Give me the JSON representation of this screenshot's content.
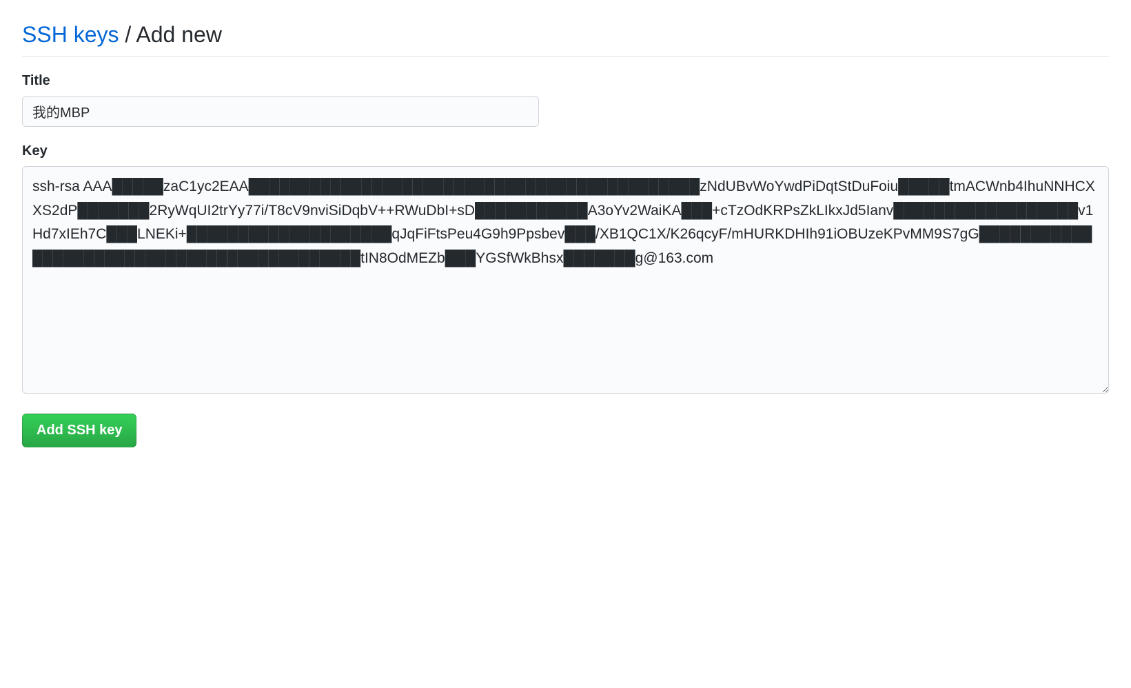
{
  "header": {
    "link_text": "SSH keys",
    "separator": " / ",
    "current": "Add new"
  },
  "form": {
    "title_label": "Title",
    "title_value": "我的MBP",
    "key_label": "Key",
    "key_value": "ssh-rsa AAA█████zaC1yc2EAA████████████████████████████████████████████zNdUBvWoYwdPiDqtStDuFoiu█████tmACWnb4IhuNNHCXXS2dP███████2RyWqUI2trYy77i/T8cV9nviSiDqbV++RWuDbI+sD███████████A3oYv2WaiKA███+cTzOdKRPsZkLIkxJd5Ianv██████████████████v1Hd7xIEh7C███LNEKi+████████████████████qJqFiFtsPeu4G9h9Ppsbev███/XB1QC1X/K26qcyF/mHURKDHIh91iOBUzeKPvMM9S7gG███████████████████████████████████████████tIN8OdMEZb███YGSfWkBhsx███████g@163.com",
    "submit_label": "Add SSH key"
  }
}
